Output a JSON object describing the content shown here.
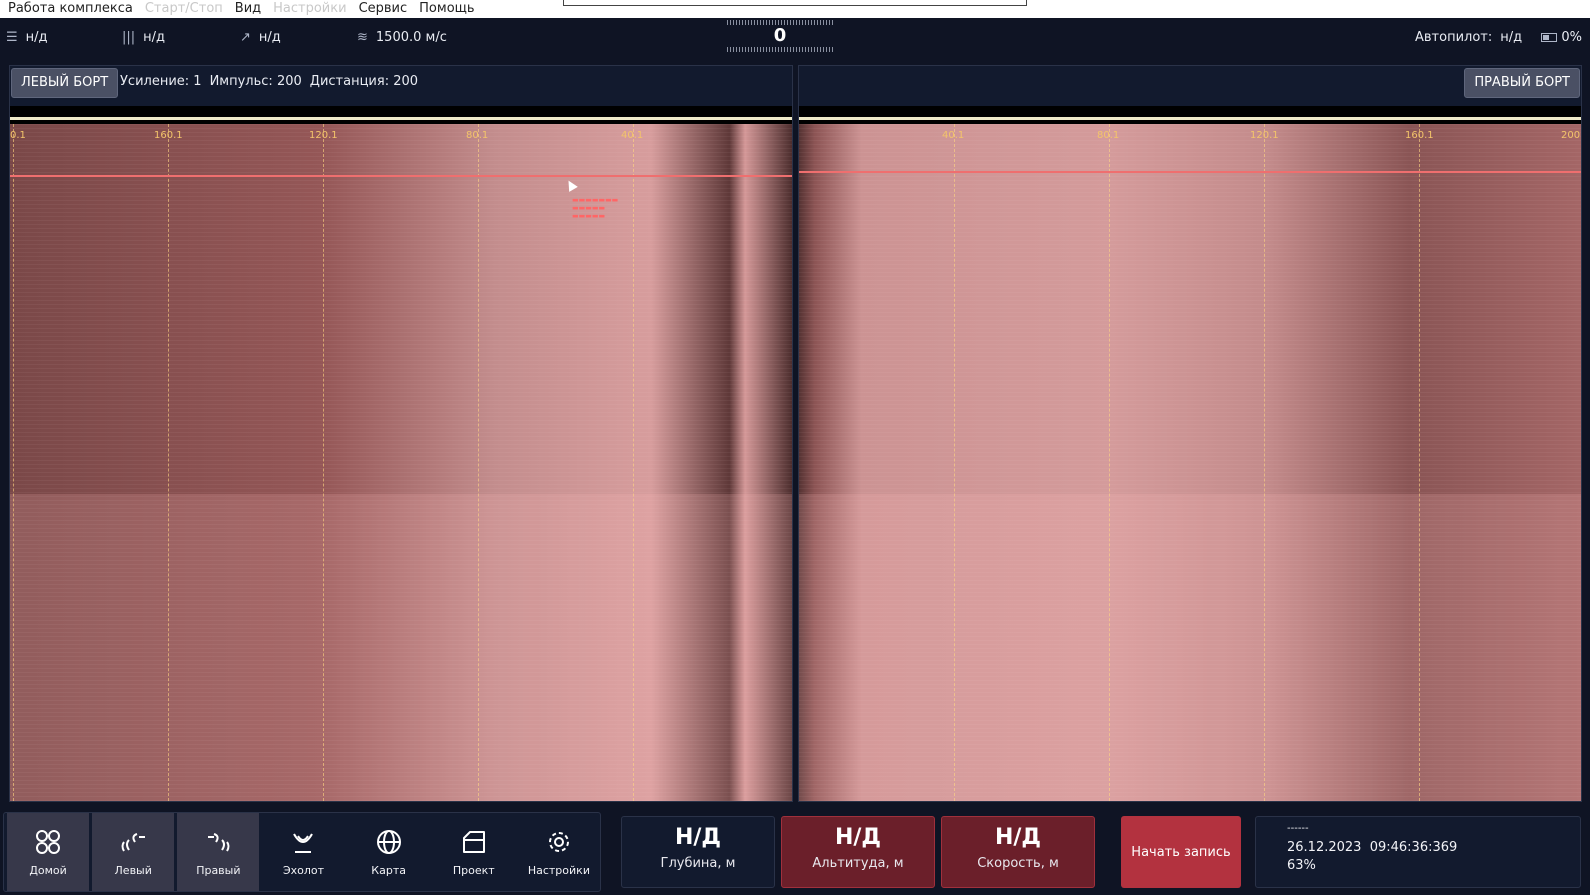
{
  "menu": {
    "items": [
      "Работа комплекса",
      "Старт/Стоп",
      "Вид",
      "Настройки",
      "Сервис",
      "Помощь"
    ],
    "disabled": [
      false,
      true,
      false,
      true,
      false,
      false
    ]
  },
  "status": {
    "menu_value": "н/д",
    "bars_value": "н/д",
    "arrow_value": "н/д",
    "sound_speed": "1500.0 м/с",
    "heading": "0",
    "autopilot_label": "Автопилот:",
    "autopilot_value": "н/д",
    "battery": "0%"
  },
  "left_panel": {
    "button": "ЛЕВЫЙ БОРТ",
    "gain_label": "Усиление:",
    "gain": "1",
    "pulse_label": "Импульс:",
    "pulse": "200",
    "distance_label": "Дистанция:",
    "distance": "200",
    "ticks": [
      "0.1",
      "160.1",
      "120.1",
      "80.1",
      "40.1"
    ]
  },
  "right_panel": {
    "button": "ПРАВЫЙ БОРТ",
    "ticks": [
      "40.1",
      "80.1",
      "120.1",
      "160.1",
      "200"
    ]
  },
  "dock": [
    {
      "label": "Домой",
      "icon": "home-grid-icon",
      "active": true
    },
    {
      "label": "Левый",
      "icon": "left-sonar-icon",
      "active": true
    },
    {
      "label": "Правый",
      "icon": "right-sonar-icon",
      "active": true
    },
    {
      "label": "Эхолот",
      "icon": "echosounder-icon",
      "active": false
    },
    {
      "label": "Карта",
      "icon": "globe-icon",
      "active": false
    },
    {
      "label": "Проект",
      "icon": "folder-icon",
      "active": false
    },
    {
      "label": "Настройки",
      "icon": "gear-icon",
      "active": false
    }
  ],
  "metrics": {
    "depth": {
      "value": "Н/Д",
      "label": "Глубина, м"
    },
    "altitude": {
      "value": "Н/Д",
      "label": "Альтитуда, м"
    },
    "speed": {
      "value": "Н/Д",
      "label": "Скорость, м"
    }
  },
  "record_button": "Начать запись",
  "info": {
    "dashes": "------",
    "date": "26.12.2023",
    "time": "09:46:36:369",
    "percent": "63%"
  },
  "colors": {
    "background": "#0f1424",
    "sonar_tint": "#c98f8f",
    "alert": "#6b1f2a",
    "record": "#b3323f",
    "tick": "#f3c46a"
  }
}
